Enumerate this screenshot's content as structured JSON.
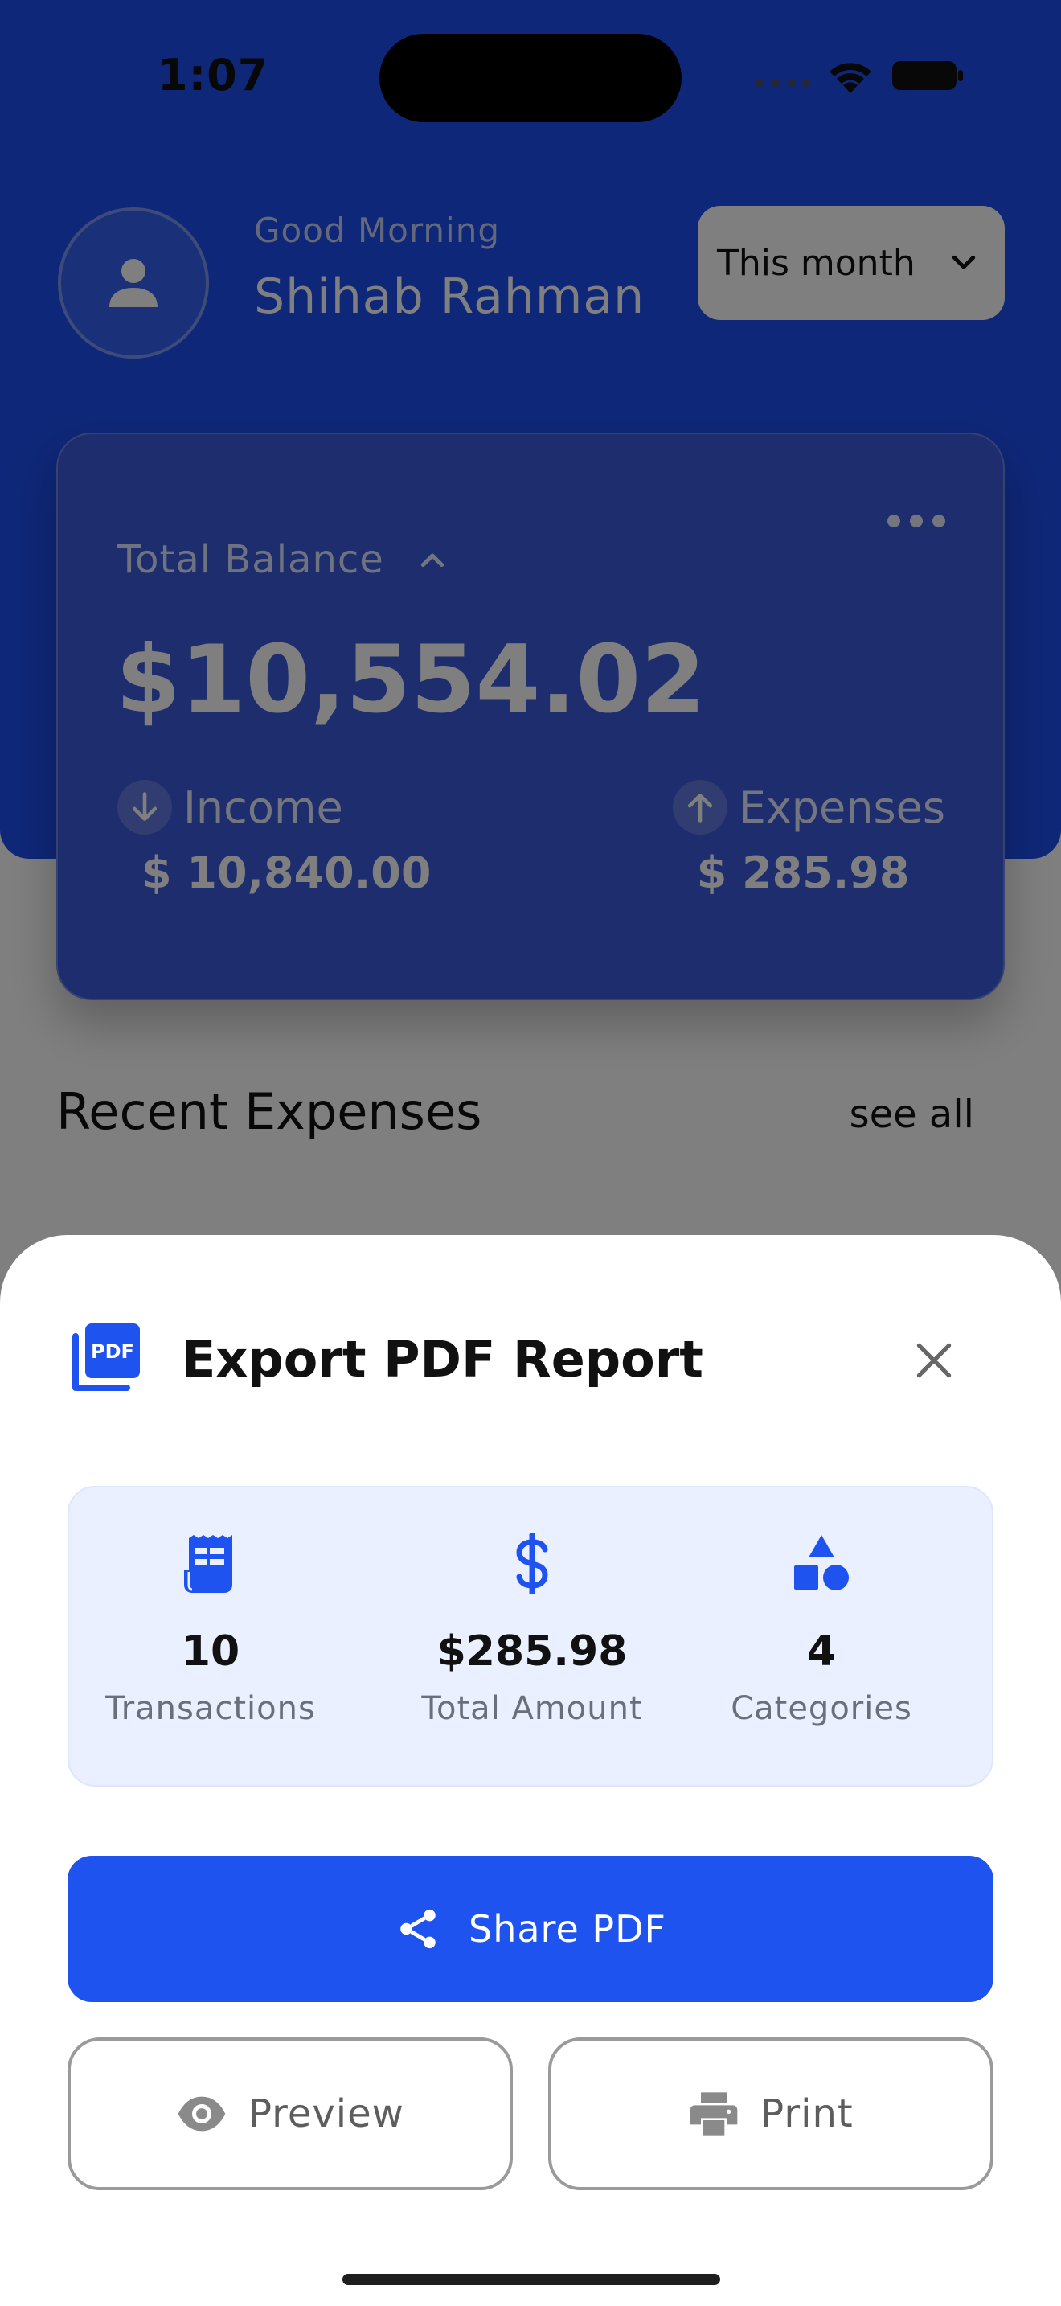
{
  "status_bar": {
    "time": "1:07"
  },
  "header": {
    "greeting": "Good Morning",
    "user_name": "Shihab Rahman",
    "period_select": "This month"
  },
  "balance_card": {
    "label": "Total Balance",
    "amount": "$10,554.02",
    "income": {
      "label": "Income",
      "value": "$ 10,840.00"
    },
    "expenses": {
      "label": "Expenses",
      "value": "$ 285.98"
    }
  },
  "recent": {
    "title": "Recent Expenses",
    "see_all": "see all"
  },
  "sheet": {
    "title": "Export PDF Report",
    "icon_text": "PDF",
    "stats": [
      {
        "value": "10",
        "label": "Transactions",
        "icon": "receipt-icon"
      },
      {
        "value": "$285.98",
        "label": "Total Amount",
        "icon": "dollar-icon"
      },
      {
        "value": "4",
        "label": "Categories",
        "icon": "category-shapes-icon"
      }
    ],
    "share_label": "Share PDF",
    "preview_label": "Preview",
    "print_label": "Print"
  },
  "colors": {
    "primary": "#1f53ef",
    "summary_bg": "#eaf0ff",
    "header_bg": "#1d4ff0"
  }
}
